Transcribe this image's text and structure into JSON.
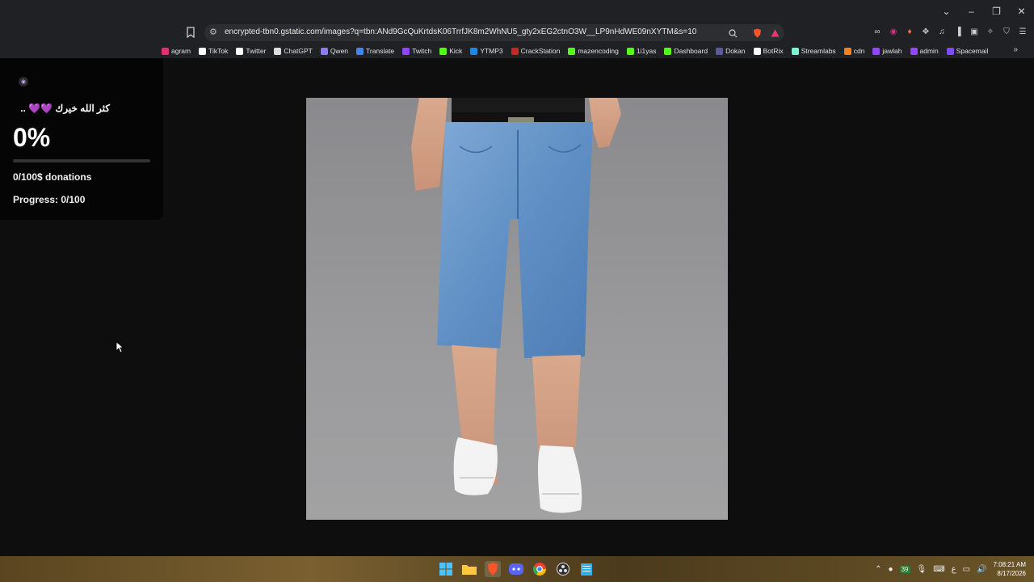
{
  "browser": {
    "url": "encrypted-tbn0.gstatic.com/images?q=tbn:ANd9GcQuKrtdsK06TrrfJK8m2WhNU5_gty2xEG2ctnO3W__LP9nHdWE09nXYTM&s=10",
    "bookmarks": [
      {
        "label": "agram",
        "icon": "instagram-icon",
        "color": "#e1306c"
      },
      {
        "label": "TikTok",
        "icon": "tiktok-icon",
        "color": "#ffffff"
      },
      {
        "label": "Twitter",
        "icon": "x-icon",
        "color": "#ffffff"
      },
      {
        "label": "ChatGPT",
        "icon": "chatgpt-icon",
        "color": "#dddddd"
      },
      {
        "label": "Qwen",
        "icon": "qwen-icon",
        "color": "#8a7cff"
      },
      {
        "label": "Translate",
        "icon": "translate-icon",
        "color": "#4285f4"
      },
      {
        "label": "Twitch",
        "icon": "twitch-icon",
        "color": "#9146ff"
      },
      {
        "label": "Kick",
        "icon": "kick-icon",
        "color": "#53fc18"
      },
      {
        "label": "YTMP3",
        "icon": "ytmp3-icon",
        "color": "#1e88e5"
      },
      {
        "label": "CrackStation",
        "icon": "crackstation-icon",
        "color": "#c62828"
      },
      {
        "label": "mazencoding",
        "icon": "kick-icon",
        "color": "#53fc18"
      },
      {
        "label": "1i1yas",
        "icon": "kick-icon",
        "color": "#53fc18"
      },
      {
        "label": "Dashboard",
        "icon": "kick-icon",
        "color": "#53fc18"
      },
      {
        "label": "Dokan",
        "icon": "dokan-icon",
        "color": "#5b5b9b"
      },
      {
        "label": "BotRix",
        "icon": "botrix-icon",
        "color": "#ffffff"
      },
      {
        "label": "Streamlabs",
        "icon": "streamlabs-icon",
        "color": "#80f5d2"
      },
      {
        "label": "cdn",
        "icon": "cdn-icon",
        "color": "#f48120"
      },
      {
        "label": "jawlah",
        "icon": "jawlah-icon",
        "color": "#9146ff"
      },
      {
        "label": "admin",
        "icon": "admin-icon",
        "color": "#9146ff"
      },
      {
        "label": "Spacemail",
        "icon": "spacemail-icon",
        "color": "#7c4dff"
      }
    ]
  },
  "donation": {
    "message": "كثر الله خيرك 💜💜 ..",
    "percent": "0%",
    "progress_fraction": 0,
    "donations": "0/100$ donations",
    "progress": "Progress: 0/100",
    "accent": "#8e44ff"
  },
  "taskbar": {
    "time": "7:08:21 AM",
    "date": "8/17/2026",
    "tray_badge": "39",
    "lang": "ع"
  }
}
